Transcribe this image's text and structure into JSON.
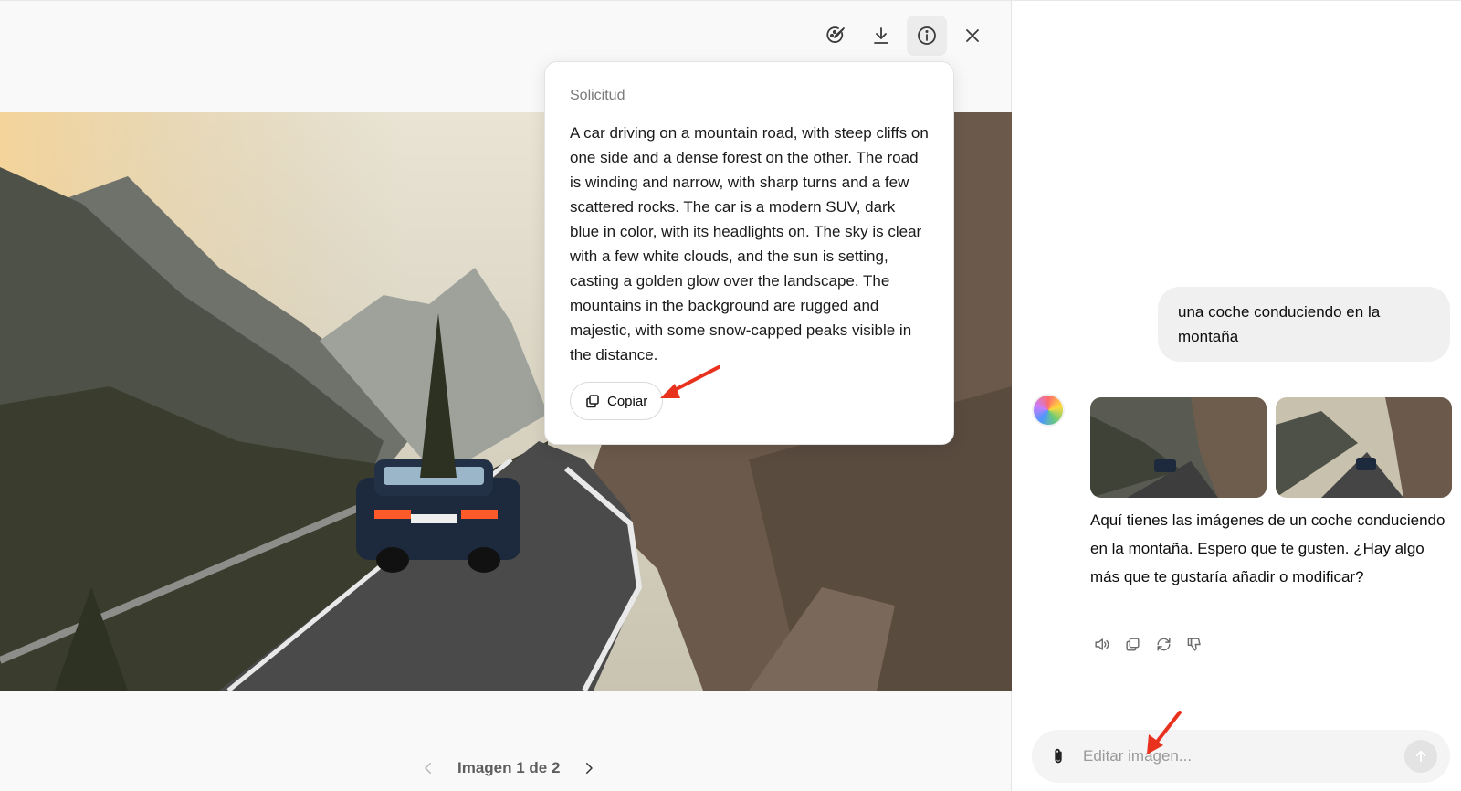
{
  "viewer": {
    "toolbar": {
      "icons": [
        "edit-style-icon",
        "download-icon",
        "info-icon",
        "close-icon"
      ]
    },
    "pager": {
      "label": "Imagen 1 de 2"
    },
    "popover": {
      "title": "Solicitud",
      "prompt": "A car driving on a mountain road, with steep cliffs on one side and a dense forest on the other. The road is winding and narrow, with sharp turns and a few scattered rocks. The car is a modern SUV, dark blue in color, with its headlights on. The sky is clear with a few white clouds, and the sun is setting, casting a golden glow over the landscape. The mountains in the background are rugged and majestic, with some snow-capped peaks visible in the distance.",
      "copy_label": "Copiar"
    }
  },
  "chat": {
    "user_message": "una coche conduciendo en la montaña",
    "assistant_message": "Aquí tienes las imágenes de un coche conduciendo en la montaña. Espero que te gusten. ¿Hay algo más que te gustaría añadir o modificar?",
    "actions": [
      "speaker-icon",
      "copy-icon",
      "regenerate-icon",
      "thumbs-down-icon"
    ],
    "composer": {
      "placeholder": "Editar imagen..."
    }
  },
  "colors": {
    "annotation_arrow": "#e8321e",
    "popover_bg": "#ffffff",
    "viewer_bg": "#f9f9f9"
  }
}
